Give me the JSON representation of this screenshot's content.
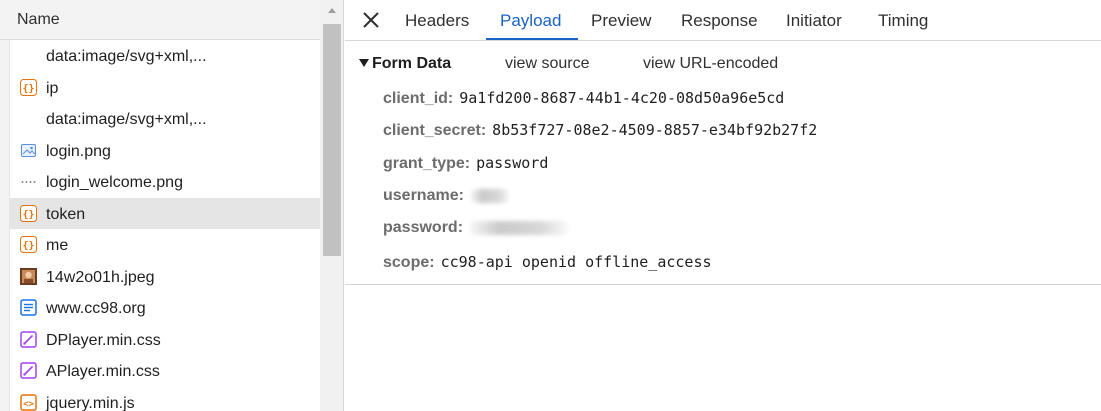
{
  "request_list": {
    "header": "Name",
    "rows": [
      {
        "label": "data:image/svg+xml,...",
        "icon": "none",
        "selected": false
      },
      {
        "label": "ip",
        "icon": "json-icon",
        "selected": false
      },
      {
        "label": "data:image/svg+xml,...",
        "icon": "none",
        "selected": false
      },
      {
        "label": "login.png",
        "icon": "image-icon",
        "selected": false
      },
      {
        "label": "login_welcome.png",
        "icon": "dotted-image-icon",
        "selected": false
      },
      {
        "label": "token",
        "icon": "json-icon",
        "selected": true
      },
      {
        "label": "me",
        "icon": "json-icon",
        "selected": false
      },
      {
        "label": "14w2o01h.jpeg",
        "icon": "photo-thumbnail-icon",
        "selected": false
      },
      {
        "label": "www.cc98.org",
        "icon": "document-icon",
        "selected": false
      },
      {
        "label": "DPlayer.min.css",
        "icon": "stylesheet-icon",
        "selected": false
      },
      {
        "label": "APlayer.min.css",
        "icon": "stylesheet-icon",
        "selected": false
      },
      {
        "label": "jquery.min.js",
        "icon": "script-icon",
        "selected": false
      }
    ]
  },
  "details": {
    "tabs": [
      "Headers",
      "Payload",
      "Preview",
      "Response",
      "Initiator",
      "Timing"
    ],
    "active_tab": "Payload",
    "form": {
      "title": "Form Data",
      "view_source": "view source",
      "view_url_encoded": "view URL-encoded",
      "fields": [
        {
          "key": "client_id:",
          "value": "9a1fd200-8687-44b1-4c20-08d50a96e5cd"
        },
        {
          "key": "client_secret:",
          "value": "8b53f727-08e2-4509-8857-e34bf92b27f2"
        },
        {
          "key": "grant_type:",
          "value": "password"
        },
        {
          "key": "username:",
          "value": ""
        },
        {
          "key": "password:",
          "value": ""
        },
        {
          "key": "scope:",
          "value": "cc98-api openid offline_access"
        }
      ]
    }
  },
  "colors": {
    "accent": "#1a62c6",
    "json_icon": "#e8710a",
    "css_icon": "#a142f4",
    "doc_icon": "#1a73e8",
    "selected_row": "#e5e5e5"
  }
}
